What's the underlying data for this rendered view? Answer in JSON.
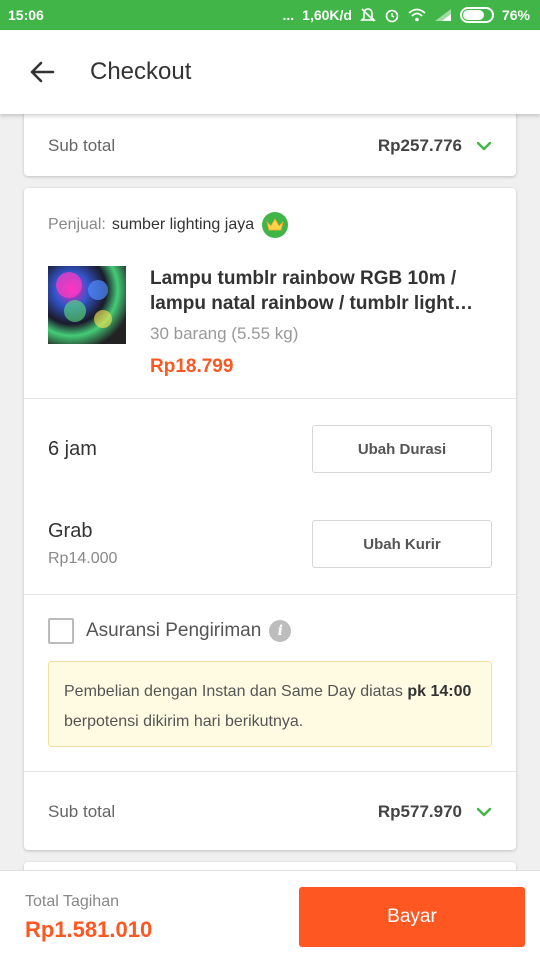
{
  "status_bar": {
    "time": "15:06",
    "dots": "...",
    "network_speed": "1,60K/d",
    "battery": "76%",
    "battery_level": 0.76
  },
  "header": {
    "title": "Checkout",
    "back_icon": "arrow-left-icon"
  },
  "cards": {
    "previous": {
      "subtotal_label": "Sub total",
      "subtotal_value": "Rp257.776"
    },
    "current": {
      "seller_label": "Penjual:",
      "seller_name": "sumber lighting jaya",
      "seller_badge_icon": "crown-icon",
      "product": {
        "name": "Lampu tumblr rainbow RGB 10m / lampu natal rainbow / tumblr light dekorasi",
        "quantity": "30 barang (5.55 kg)",
        "price": "Rp18.799"
      },
      "duration": {
        "value": "6 jam",
        "button_label": "Ubah Durasi"
      },
      "courier": {
        "name": "Grab",
        "price": "Rp14.000",
        "button_label": "Ubah Kurir"
      },
      "insurance": {
        "label": "Asuransi Pengiriman",
        "checked": false,
        "info_icon": "info-icon"
      },
      "notice": {
        "text_before": "Pembelian dengan Instan dan Same Day diatas ",
        "bold_time": "pk 14:00",
        "text_after": " berpotensi dikirim hari berikutnya."
      },
      "subtotal_label": "Sub total",
      "subtotal_value": "Rp577.970"
    }
  },
  "footer": {
    "total_label": "Total Tagihan",
    "total_value": "Rp1.581.010",
    "pay_button": "Bayar"
  },
  "colors": {
    "brand_green": "#42b549",
    "accent_orange": "#ff5722"
  }
}
